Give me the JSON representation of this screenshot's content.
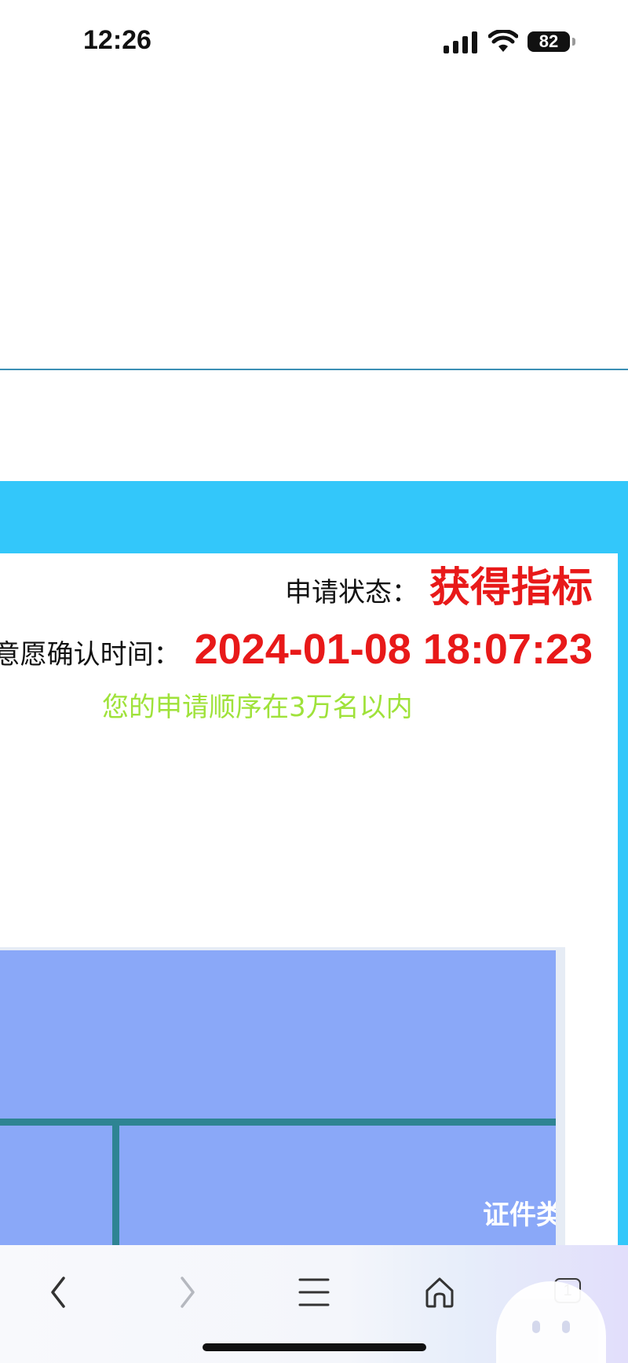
{
  "status_bar": {
    "time": "12:26",
    "battery": "82",
    "icons": [
      "signal-icon",
      "wifi-icon",
      "battery-icon"
    ]
  },
  "application": {
    "status_label": "申请状态：",
    "status_value": "获得指标",
    "confirm_time_label": "意愿确认时间：",
    "confirm_time_value": "2024-01-08 18:07:23",
    "order_note": "您的申请顺序在3万名以内"
  },
  "table": {
    "cell_label": "证件类"
  },
  "toolbar": {
    "tab_count": "1",
    "icons": [
      "back-icon",
      "forward-icon",
      "menu-icon",
      "home-icon",
      "tabs-icon"
    ]
  },
  "colors": {
    "accent_cyan": "#33c7fa",
    "status_red": "#e81919",
    "note_green": "#9fe23a",
    "table_blue": "#8aa8f8",
    "table_line": "#2e8493"
  }
}
